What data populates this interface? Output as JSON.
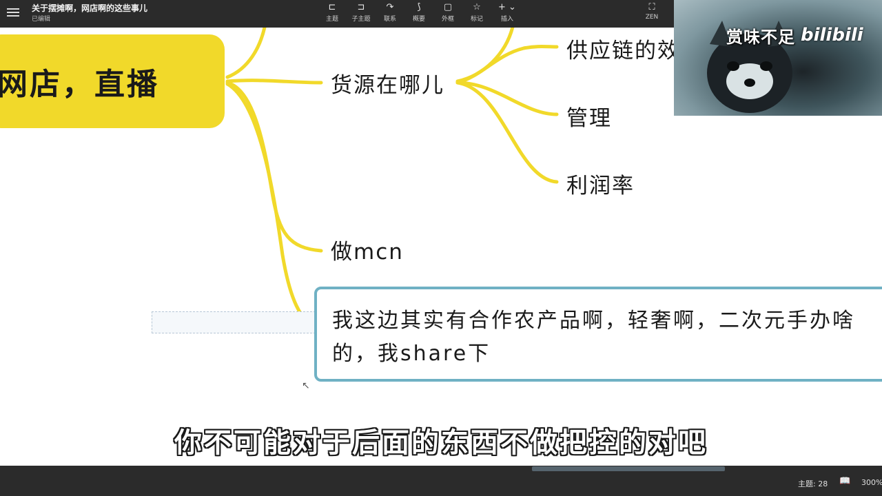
{
  "header": {
    "title": "关于摆摊啊，网店啊的这些事儿",
    "status": "已编辑"
  },
  "toolbar": {
    "items": [
      {
        "label": "主题",
        "icon": "topic-icon"
      },
      {
        "label": "子主题",
        "icon": "subtopic-icon"
      },
      {
        "label": "联系",
        "icon": "relationship-icon"
      },
      {
        "label": "概要",
        "icon": "summary-icon"
      },
      {
        "label": "外框",
        "icon": "boundary-icon"
      },
      {
        "label": "标记",
        "icon": "marker-icon"
      },
      {
        "label": "插入",
        "icon": "insert-icon"
      }
    ],
    "zen_label": "ZEN"
  },
  "mindmap": {
    "root": "网店，直播",
    "branches": [
      {
        "label": "货源在哪儿",
        "children": [
          "供应链的效",
          "管理",
          "利润率"
        ]
      },
      {
        "label": "做mcn"
      }
    ],
    "note": "我这边其实有合作农产品啊，轻奢啊，二次元手办啥的，我share下"
  },
  "video_overlay": {
    "caption": "赏味不足",
    "logo": "bilibili"
  },
  "subtitle": "你不可能对于后面的东西不做把控的对吧",
  "statusbar": {
    "topic_count": "主题: 28",
    "zoom": "300%"
  },
  "colors": {
    "branch": "#f1d92a",
    "note_border": "#6fb1c4",
    "toolbar_bg": "#2b2b2b"
  }
}
